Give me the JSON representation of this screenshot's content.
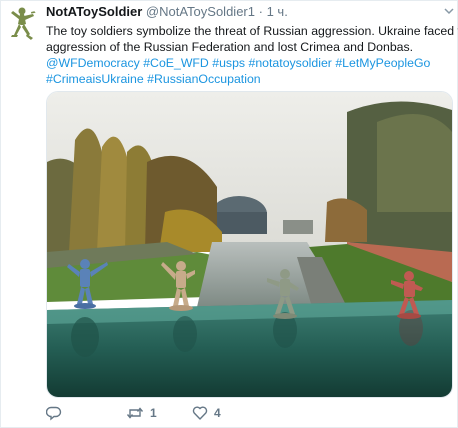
{
  "tweet": {
    "display_name": "NotAToySoldier",
    "handle": "@NotAToySoldier1",
    "separator": "·",
    "time": "1 ч.",
    "text_line1": "The toy soldiers symbolize the threat of Russian aggression. Ukraine faced the",
    "text_line2": "aggression of the Russian Federation and lost Crimea and Donbas.",
    "tags_line3": [
      "@WFDemocracy",
      "#CoE_WFD",
      "#usps",
      "#notatoysoldier",
      "#LetMyPeopleGo"
    ],
    "tags_line4": [
      "#CrimeaisUkraine",
      "#RussianOccupation"
    ],
    "retweet_count": "1",
    "like_count": "4"
  },
  "icons": {
    "avatar": "toy-soldier-avatar",
    "more": "chevron-down-icon",
    "reply": "reply-icon",
    "retweet": "retweet-icon",
    "like": "heart-icon"
  },
  "colors": {
    "link": "#1b95e0",
    "secondary_text": "#657786",
    "avatar_figure": "#7a8d4a"
  }
}
